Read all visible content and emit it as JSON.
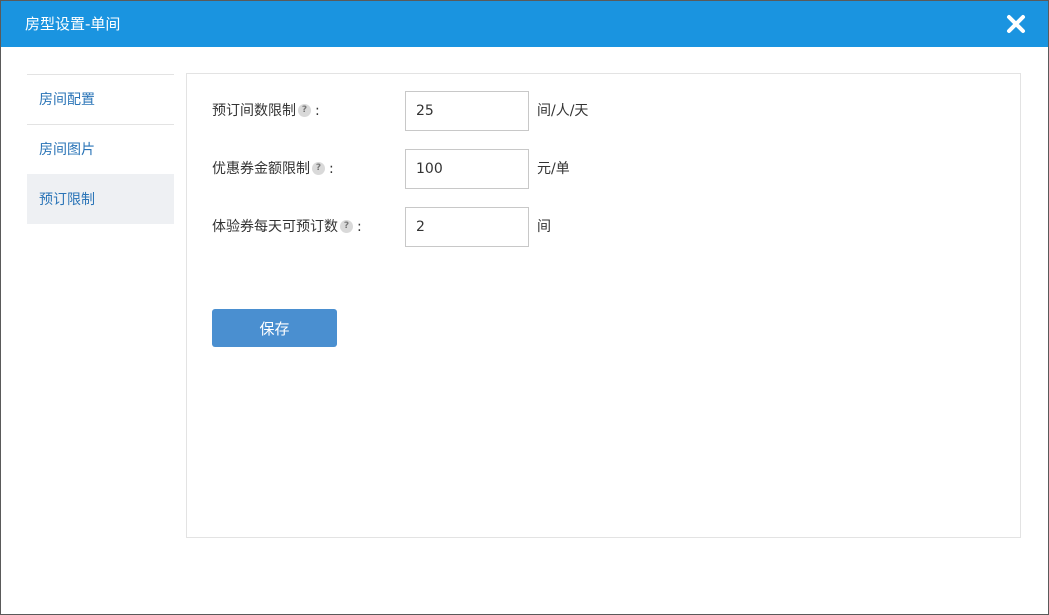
{
  "dialog": {
    "title": "房型设置-单间",
    "close_icon": "close-icon"
  },
  "sidebar": {
    "items": [
      {
        "label": "房间配置",
        "active": false
      },
      {
        "label": "房间图片",
        "active": false
      },
      {
        "label": "预订限制",
        "active": true
      }
    ]
  },
  "form": {
    "rows": [
      {
        "label": "预订间数限制",
        "colon": ":",
        "value": "25",
        "unit": "间/人/天"
      },
      {
        "label": "优惠券金额限制",
        "colon": ":",
        "value": "100",
        "unit": "元/单"
      },
      {
        "label": "体验券每天可预订数",
        "colon": ":",
        "value": "2",
        "unit": "间"
      }
    ],
    "help_glyph": "?",
    "save_label": "保存"
  },
  "colors": {
    "titlebar": "#1a94e0",
    "link": "#2a74b7",
    "button": "#4a8fd0"
  }
}
